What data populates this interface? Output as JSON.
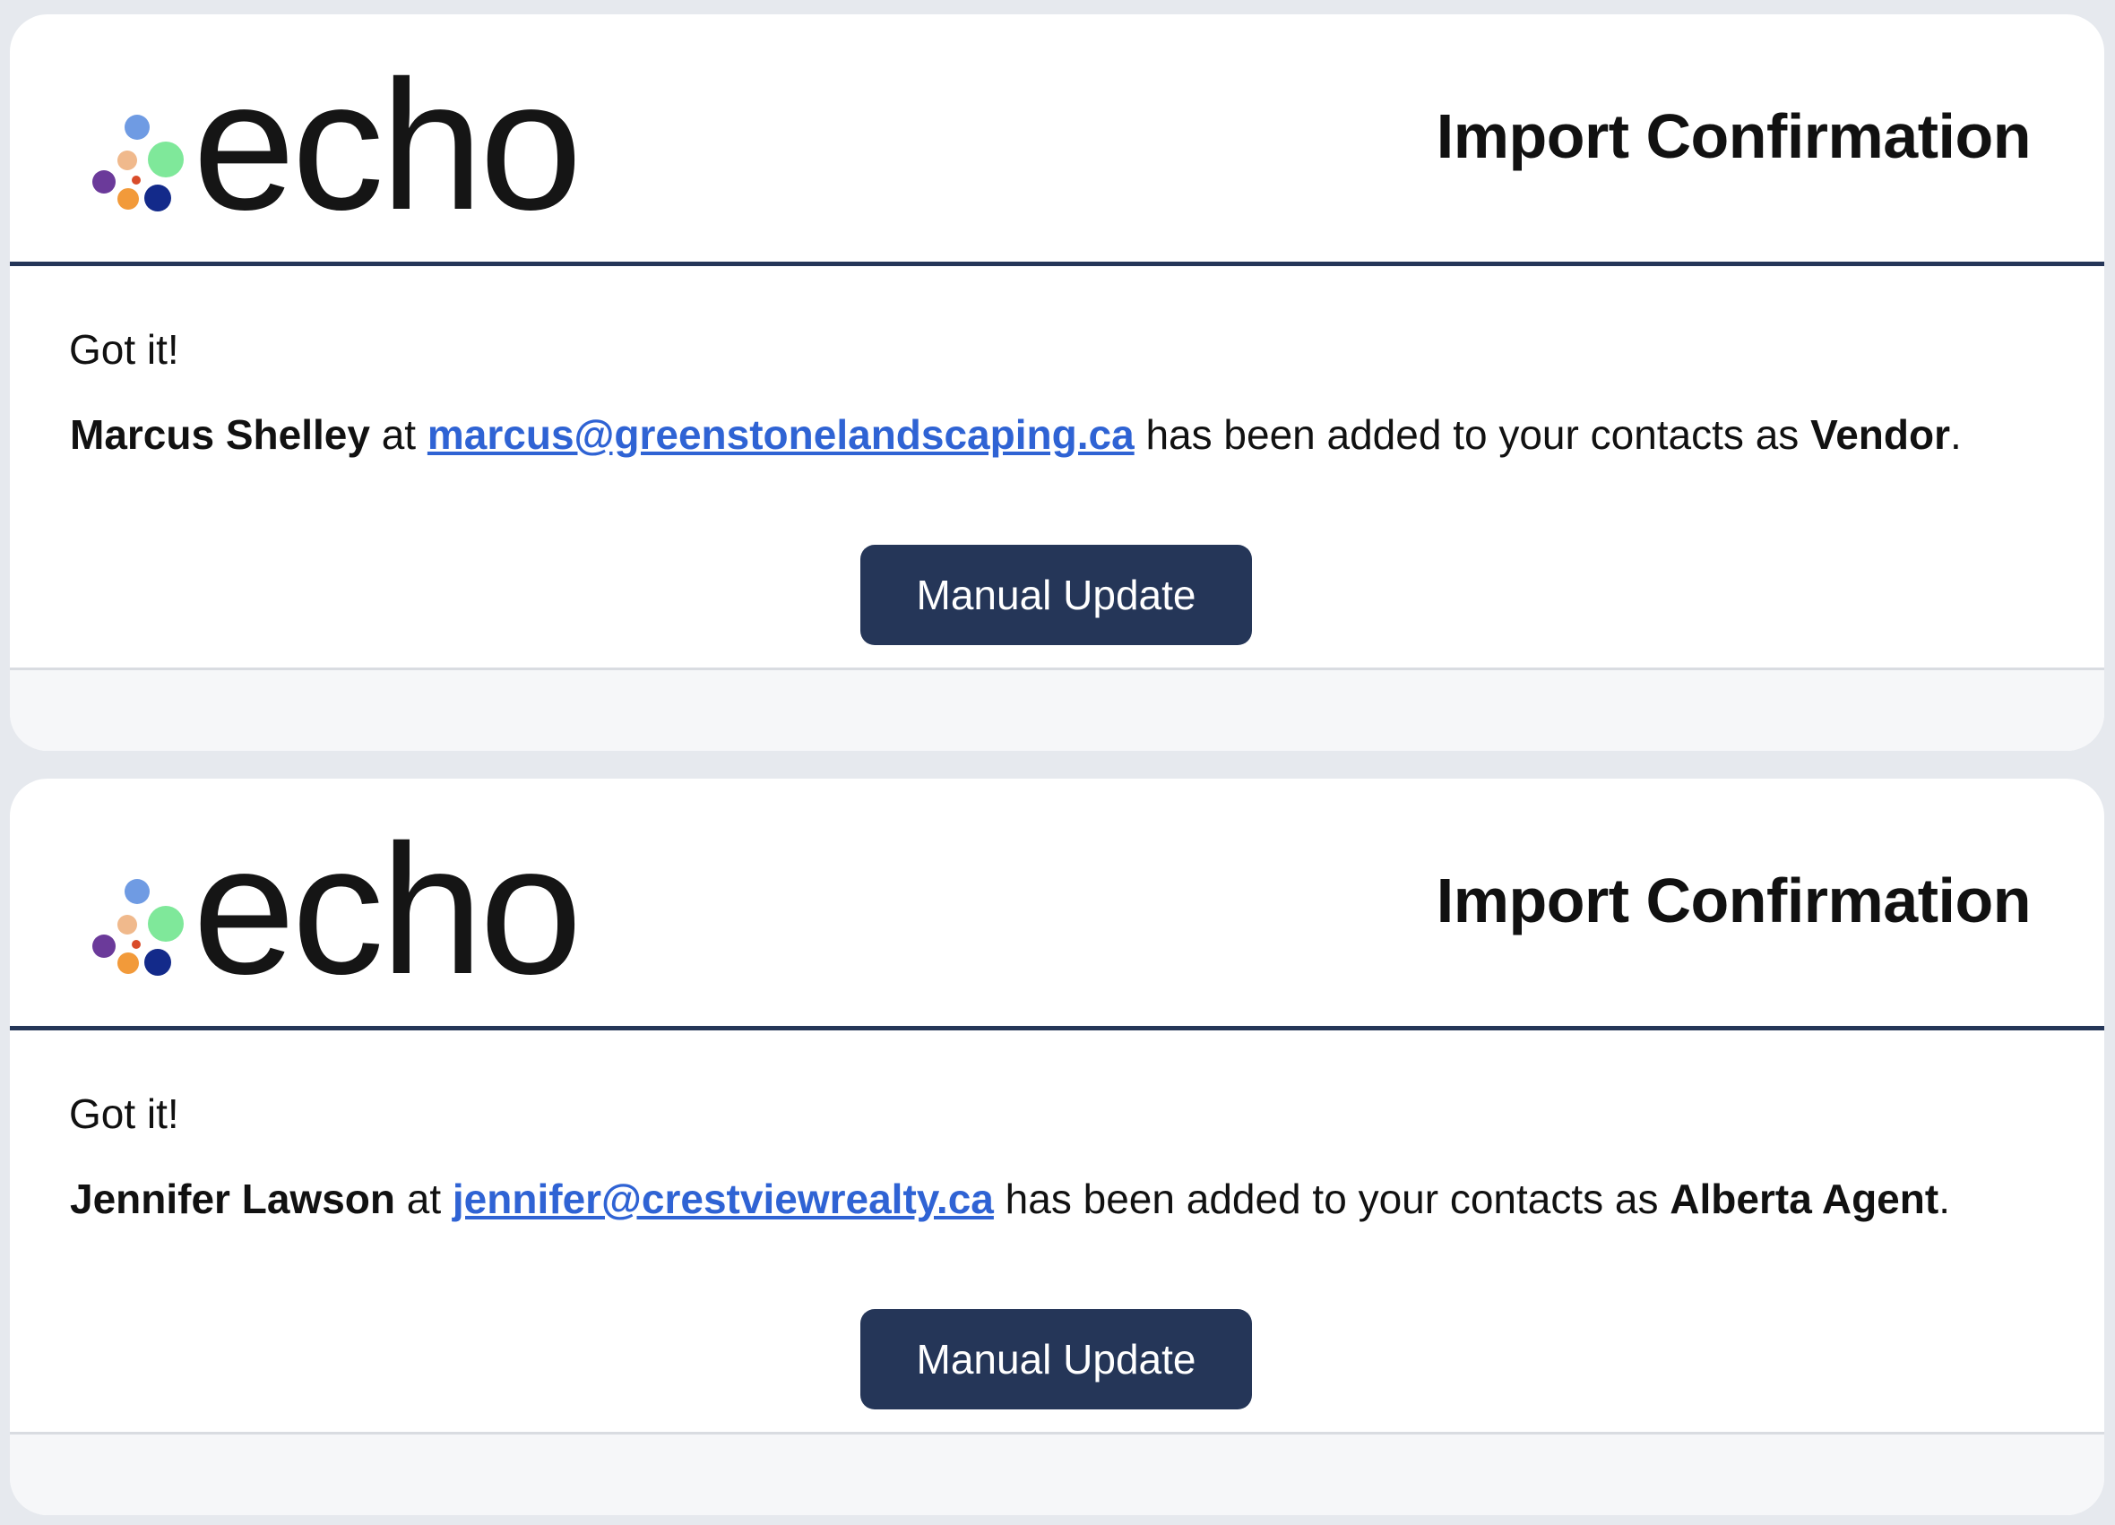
{
  "brand": {
    "logo_text": "echo",
    "dot_colors": [
      "#6f9be3",
      "#f0b98c",
      "#7fe89a",
      "#6b3a9a",
      "#d94c2a",
      "#f29a3a",
      "#132a8a"
    ]
  },
  "colors": {
    "accent": "#253658",
    "link": "#2f63d4",
    "background": "#e6e9ee"
  },
  "confirmations": [
    {
      "title": "Import Confirmation",
      "greeting": "Got it!",
      "contact_name": "Marcus Shelley",
      "connector": " at ",
      "email": "marcus@greenstonelandscaping.ca",
      "added_text": " has been added to your contacts as ",
      "role": "Vendor",
      "end": ".",
      "button_label": "Manual Update"
    },
    {
      "title": "Import Confirmation",
      "greeting": "Got it!",
      "contact_name": "Jennifer Lawson",
      "connector": " at ",
      "email": "jennifer@crestviewrealty.ca",
      "added_text": " has been added to your contacts as ",
      "role": "Alberta Agent",
      "end": ".",
      "button_label": "Manual Update"
    }
  ]
}
